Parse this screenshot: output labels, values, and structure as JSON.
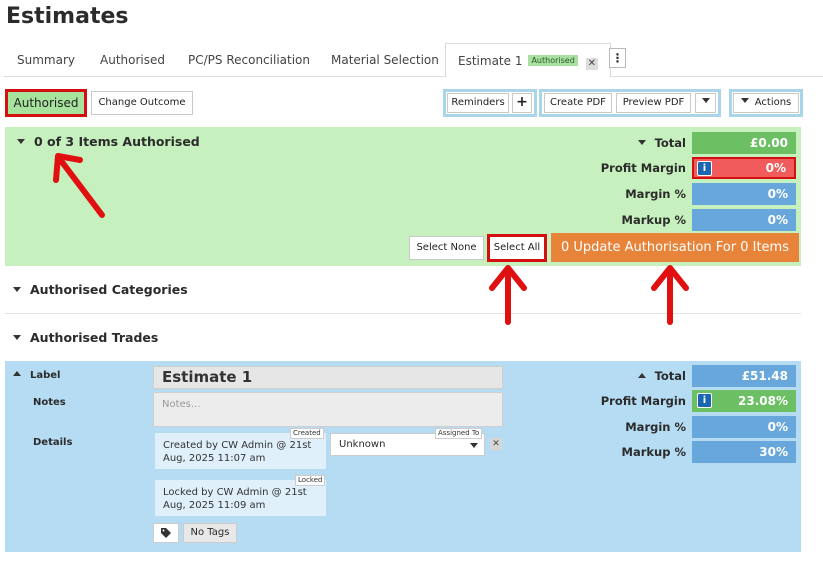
{
  "page": {
    "title": "Estimates"
  },
  "tabs": [
    {
      "label": "Summary"
    },
    {
      "label": "Authorised"
    },
    {
      "label": "PC/PS Reconciliation"
    },
    {
      "label": "Material Selection"
    }
  ],
  "active_tab": {
    "label": "Estimate 1",
    "badge": "Authorised",
    "close": "✕"
  },
  "tab_menu": "⋮",
  "toolbar": {
    "status": "Authorised",
    "change_outcome": "Change Outcome",
    "reminders": "Reminders",
    "add": "+",
    "create_pdf": "Create PDF",
    "preview_pdf": "Preview PDF",
    "actions": "Actions"
  },
  "authorisation": {
    "heading": "0 of 3 Items Authorised",
    "total_label": "Total",
    "total_value": "£0.00",
    "profit_margin_label": "Profit Margin",
    "profit_margin_value": "0%",
    "margin_label": "Margin %",
    "margin_value": "0%",
    "markup_label": "Markup %",
    "markup_value": "0%",
    "select_none": "Select None",
    "select_all": "Select All",
    "update_button": "0 Update Authorisation For 0 Items"
  },
  "sections": {
    "categories": "Authorised Categories",
    "trades": "Authorised Trades"
  },
  "estimate": {
    "label_label": "Label",
    "label_value": "Estimate 1",
    "notes_label": "Notes",
    "notes_placeholder": "Notes...",
    "details_label": "Details",
    "created_tag": "Created",
    "created_text": "Created by CW Admin @ 21st Aug, 2025 11:07 am",
    "assigned_tag": "Assigned To",
    "assigned_value": "Unknown",
    "locked_tag": "Locked",
    "locked_text": "Locked by CW Admin @ 21st Aug, 2025 11:09 am",
    "no_tags": "No Tags",
    "clear": "✕",
    "total_label": "Total",
    "total_value": "£51.48",
    "profit_margin_label": "Profit Margin",
    "profit_margin_value": "23.08%",
    "margin_label": "Margin %",
    "margin_value": "0%",
    "markup_label": "Markup %",
    "markup_value": "30%"
  },
  "colors": {
    "highlight_red": "#d21010",
    "success_green": "#6cbf63",
    "danger_red": "#f25b5b",
    "metric_blue": "#68a7db",
    "update_orange": "#e8833a",
    "panel_green": "#c6f0bd",
    "panel_blue": "#b5dcf3"
  },
  "icons": {
    "info": "i",
    "tag": "tag-icon",
    "caret_down": "caret-down-icon",
    "caret_up": "caret-up-icon"
  }
}
